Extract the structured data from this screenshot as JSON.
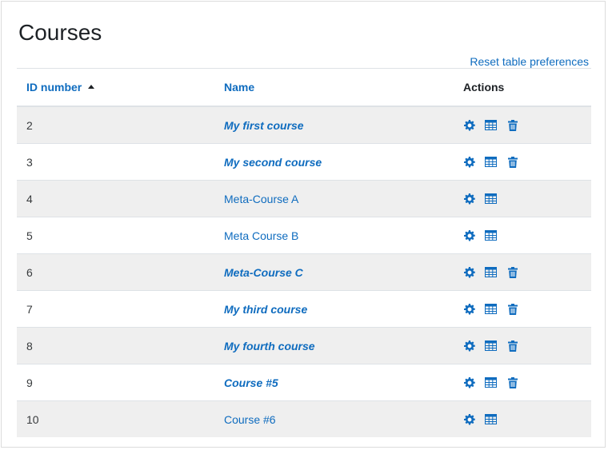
{
  "page": {
    "title": "Courses",
    "reset_link": "Reset table preferences",
    "accent_color": "#0f6cbf"
  },
  "table": {
    "columns": [
      {
        "label": "ID number",
        "sortable": true,
        "sort": "ascending"
      },
      {
        "label": "Name",
        "sortable": true
      },
      {
        "label": "Actions",
        "sortable": false
      }
    ],
    "rows": [
      {
        "id": "2",
        "name": "My first course",
        "emphasized": true,
        "actions": [
          "gear-icon",
          "table-icon",
          "trash-icon"
        ]
      },
      {
        "id": "3",
        "name": "My second course",
        "emphasized": true,
        "actions": [
          "gear-icon",
          "table-icon",
          "trash-icon"
        ]
      },
      {
        "id": "4",
        "name": "Meta-Course A",
        "emphasized": false,
        "actions": [
          "gear-icon",
          "table-icon"
        ]
      },
      {
        "id": "5",
        "name": "Meta Course B",
        "emphasized": false,
        "actions": [
          "gear-icon",
          "table-icon"
        ]
      },
      {
        "id": "6",
        "name": "Meta-Course C",
        "emphasized": true,
        "actions": [
          "gear-icon",
          "table-icon",
          "trash-icon"
        ]
      },
      {
        "id": "7",
        "name": "My third course",
        "emphasized": true,
        "actions": [
          "gear-icon",
          "table-icon",
          "trash-icon"
        ]
      },
      {
        "id": "8",
        "name": "My fourth course",
        "emphasized": true,
        "actions": [
          "gear-icon",
          "table-icon",
          "trash-icon"
        ]
      },
      {
        "id": "9",
        "name": "Course #5",
        "emphasized": true,
        "actions": [
          "gear-icon",
          "table-icon",
          "trash-icon"
        ]
      },
      {
        "id": "10",
        "name": "Course #6",
        "emphasized": false,
        "actions": [
          "gear-icon",
          "table-icon"
        ]
      }
    ]
  }
}
